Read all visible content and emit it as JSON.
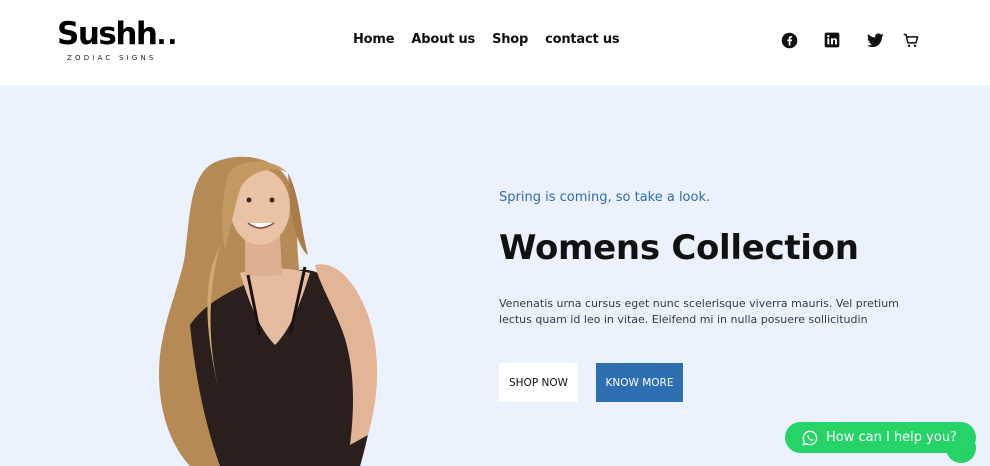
{
  "brand": {
    "name": "Sushh",
    "dots": "..",
    "tagline": "ZODIAC SIGNS"
  },
  "nav": {
    "items": [
      "Home",
      "About us",
      "Shop",
      "contact us"
    ]
  },
  "social": {
    "icons": [
      "facebook-icon",
      "linkedin-icon",
      "twitter-icon",
      "cart-icon"
    ]
  },
  "hero": {
    "tagline": "Spring is coming, so take a look.",
    "title": "Womens Collection",
    "description": "Venenatis urna cursus eget nunc scelerisque viverra mauris. Vel pretium lectus quam id leo in vitae. Eleifend mi in nulla posuere sollicitudin",
    "shop_label": "SHOP NOW",
    "know_label": "KNOW MORE"
  },
  "chat": {
    "label": "How can I help you?"
  },
  "colors": {
    "hero_bg": "#ebf2fd",
    "accent": "#2d6fb0",
    "tagline": "#2f6ea8",
    "chat": "#25d366"
  }
}
